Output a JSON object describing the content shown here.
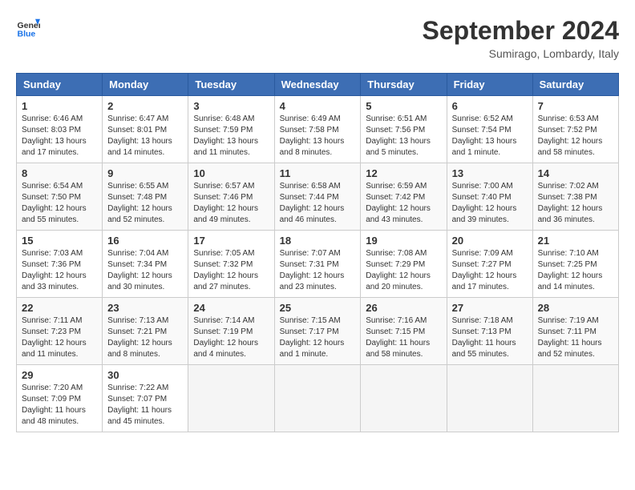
{
  "logo": {
    "line1": "General",
    "line2": "Blue"
  },
  "title": "September 2024",
  "subtitle": "Sumirago, Lombardy, Italy",
  "weekdays": [
    "Sunday",
    "Monday",
    "Tuesday",
    "Wednesday",
    "Thursday",
    "Friday",
    "Saturday"
  ],
  "weeks": [
    [
      {
        "day": "1",
        "info": "Sunrise: 6:46 AM\nSunset: 8:03 PM\nDaylight: 13 hours\nand 17 minutes."
      },
      {
        "day": "2",
        "info": "Sunrise: 6:47 AM\nSunset: 8:01 PM\nDaylight: 13 hours\nand 14 minutes."
      },
      {
        "day": "3",
        "info": "Sunrise: 6:48 AM\nSunset: 7:59 PM\nDaylight: 13 hours\nand 11 minutes."
      },
      {
        "day": "4",
        "info": "Sunrise: 6:49 AM\nSunset: 7:58 PM\nDaylight: 13 hours\nand 8 minutes."
      },
      {
        "day": "5",
        "info": "Sunrise: 6:51 AM\nSunset: 7:56 PM\nDaylight: 13 hours\nand 5 minutes."
      },
      {
        "day": "6",
        "info": "Sunrise: 6:52 AM\nSunset: 7:54 PM\nDaylight: 13 hours\nand 1 minute."
      },
      {
        "day": "7",
        "info": "Sunrise: 6:53 AM\nSunset: 7:52 PM\nDaylight: 12 hours\nand 58 minutes."
      }
    ],
    [
      {
        "day": "8",
        "info": "Sunrise: 6:54 AM\nSunset: 7:50 PM\nDaylight: 12 hours\nand 55 minutes."
      },
      {
        "day": "9",
        "info": "Sunrise: 6:55 AM\nSunset: 7:48 PM\nDaylight: 12 hours\nand 52 minutes."
      },
      {
        "day": "10",
        "info": "Sunrise: 6:57 AM\nSunset: 7:46 PM\nDaylight: 12 hours\nand 49 minutes."
      },
      {
        "day": "11",
        "info": "Sunrise: 6:58 AM\nSunset: 7:44 PM\nDaylight: 12 hours\nand 46 minutes."
      },
      {
        "day": "12",
        "info": "Sunrise: 6:59 AM\nSunset: 7:42 PM\nDaylight: 12 hours\nand 43 minutes."
      },
      {
        "day": "13",
        "info": "Sunrise: 7:00 AM\nSunset: 7:40 PM\nDaylight: 12 hours\nand 39 minutes."
      },
      {
        "day": "14",
        "info": "Sunrise: 7:02 AM\nSunset: 7:38 PM\nDaylight: 12 hours\nand 36 minutes."
      }
    ],
    [
      {
        "day": "15",
        "info": "Sunrise: 7:03 AM\nSunset: 7:36 PM\nDaylight: 12 hours\nand 33 minutes."
      },
      {
        "day": "16",
        "info": "Sunrise: 7:04 AM\nSunset: 7:34 PM\nDaylight: 12 hours\nand 30 minutes."
      },
      {
        "day": "17",
        "info": "Sunrise: 7:05 AM\nSunset: 7:32 PM\nDaylight: 12 hours\nand 27 minutes."
      },
      {
        "day": "18",
        "info": "Sunrise: 7:07 AM\nSunset: 7:31 PM\nDaylight: 12 hours\nand 23 minutes."
      },
      {
        "day": "19",
        "info": "Sunrise: 7:08 AM\nSunset: 7:29 PM\nDaylight: 12 hours\nand 20 minutes."
      },
      {
        "day": "20",
        "info": "Sunrise: 7:09 AM\nSunset: 7:27 PM\nDaylight: 12 hours\nand 17 minutes."
      },
      {
        "day": "21",
        "info": "Sunrise: 7:10 AM\nSunset: 7:25 PM\nDaylight: 12 hours\nand 14 minutes."
      }
    ],
    [
      {
        "day": "22",
        "info": "Sunrise: 7:11 AM\nSunset: 7:23 PM\nDaylight: 12 hours\nand 11 minutes."
      },
      {
        "day": "23",
        "info": "Sunrise: 7:13 AM\nSunset: 7:21 PM\nDaylight: 12 hours\nand 8 minutes."
      },
      {
        "day": "24",
        "info": "Sunrise: 7:14 AM\nSunset: 7:19 PM\nDaylight: 12 hours\nand 4 minutes."
      },
      {
        "day": "25",
        "info": "Sunrise: 7:15 AM\nSunset: 7:17 PM\nDaylight: 12 hours\nand 1 minute."
      },
      {
        "day": "26",
        "info": "Sunrise: 7:16 AM\nSunset: 7:15 PM\nDaylight: 11 hours\nand 58 minutes."
      },
      {
        "day": "27",
        "info": "Sunrise: 7:18 AM\nSunset: 7:13 PM\nDaylight: 11 hours\nand 55 minutes."
      },
      {
        "day": "28",
        "info": "Sunrise: 7:19 AM\nSunset: 7:11 PM\nDaylight: 11 hours\nand 52 minutes."
      }
    ],
    [
      {
        "day": "29",
        "info": "Sunrise: 7:20 AM\nSunset: 7:09 PM\nDaylight: 11 hours\nand 48 minutes."
      },
      {
        "day": "30",
        "info": "Sunrise: 7:22 AM\nSunset: 7:07 PM\nDaylight: 11 hours\nand 45 minutes."
      },
      {
        "day": "",
        "info": ""
      },
      {
        "day": "",
        "info": ""
      },
      {
        "day": "",
        "info": ""
      },
      {
        "day": "",
        "info": ""
      },
      {
        "day": "",
        "info": ""
      }
    ]
  ]
}
